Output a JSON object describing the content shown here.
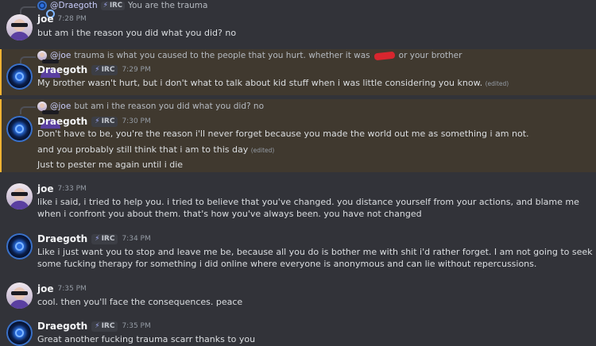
{
  "m1": {
    "reply": {
      "author": "@Draegoth",
      "tag": "IRC",
      "text": "You are the trauma"
    },
    "author": "joe",
    "time": "7:28 PM",
    "lines": [
      "but am i the reason you did what you did? no"
    ]
  },
  "m2": {
    "reply": {
      "mention": "@joe",
      "text_before": "trauma is what you caused to the people that you hurt. whether it was",
      "text_after": "or your brother"
    },
    "author": "Draegoth",
    "tag": "IRC",
    "time": "7:29 PM",
    "lines": [
      "My brother wasn't hurt, but i don't what to talk about kid stuff when i was little considering you know."
    ],
    "edited": "(edited)"
  },
  "m3": {
    "reply": {
      "mention": "@joe",
      "text": "but am i the reason you did what you did? no"
    },
    "author": "Draegoth",
    "tag": "IRC",
    "time": "7:30 PM",
    "lines": [
      "Don't have to be, you're the reason i'll never forget because you made the world out me as something i am not.",
      "and you probably still think that i am to this day",
      "Just to pester me again until i die"
    ],
    "edited": "(edited)"
  },
  "m4": {
    "author": "joe",
    "time": "7:33 PM",
    "lines": [
      "like i said, i tried to help you. i tried to believe that you've changed. you distance yourself from your actions, and blame me when i confront you about them. that's how you've always been. you have not changed"
    ]
  },
  "m5": {
    "author": "Draegoth",
    "tag": "IRC",
    "time": "7:34 PM",
    "lines": [
      "Like i just want you to stop and leave me be, because all you do is bother me with shit i'd rather forget. I am not going to seek some fucking therapy for something i did online where everyone is anonymous and can lie without repercussions."
    ]
  },
  "m6": {
    "author": "joe",
    "time": "7:35 PM",
    "lines": [
      "cool. then you'll face the consequences. peace"
    ]
  },
  "m7": {
    "author": "Draegoth",
    "tag": "IRC",
    "time": "7:35 PM",
    "lines": [
      "Great another fucking trauma scarr thanks to you"
    ]
  },
  "colors": {
    "background": "#323339",
    "highlight": "#40392f",
    "highlight_bar": "#f0b232",
    "username": "#f2f3f5",
    "mention": "#c9cdfb"
  },
  "icons": {
    "tag": "lightning-bolt-icon",
    "joe_avatar": "avatar-joe",
    "draegoth_avatar": "avatar-draegoth"
  }
}
